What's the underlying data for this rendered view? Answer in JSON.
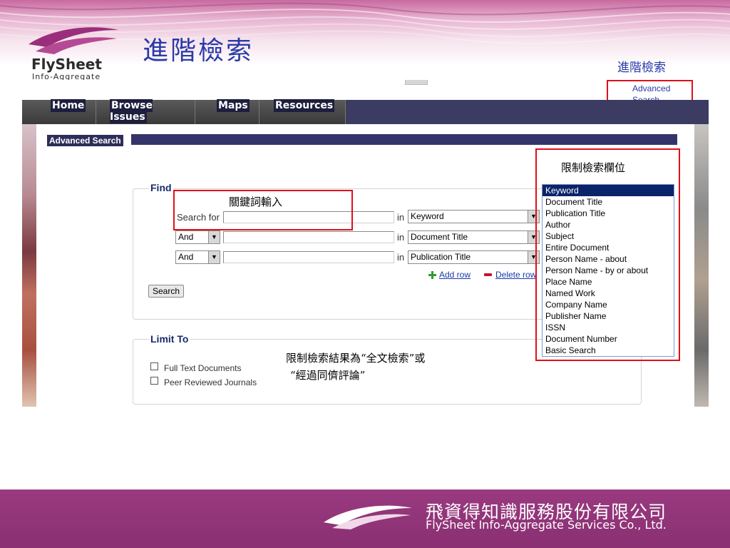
{
  "slide": {
    "title": "進階檢索",
    "top_note": "進階檢索",
    "logo": {
      "name": "FlySheet",
      "sub": "Info-Aggregate"
    },
    "company_cn": "飛資得知識服務股份有限公司",
    "company_en": "FlySheet Info-Aggregate Services Co., Ltd.",
    "colors": {
      "title": "#2a3aa8",
      "band": "#8a2f72",
      "annotation_box": "#e0101a"
    }
  },
  "nav": {
    "items": [
      {
        "label": "Home"
      },
      {
        "label": "Browse Issues"
      },
      {
        "label": "Maps"
      },
      {
        "label": "Resources"
      }
    ],
    "advanced_search_link": {
      "line1": "Advanced",
      "line2": "Search"
    }
  },
  "section": {
    "label": "Advanced Search"
  },
  "find": {
    "title": "Find",
    "search_for_label": "Search for",
    "in_label": "in",
    "rows": [
      {
        "operator": "",
        "value": "",
        "field": "Keyword"
      },
      {
        "operator": "And",
        "value": "",
        "field": "Document Title"
      },
      {
        "operator": "And",
        "value": "",
        "field": "Publication Title"
      }
    ],
    "add_row": "Add row",
    "delete_row": "Delete row",
    "search_button": "Search"
  },
  "limit": {
    "title": "Limit To",
    "options": [
      {
        "label": "Full Text Documents",
        "checked": false
      },
      {
        "label": "Peer Reviewed Journals",
        "checked": false
      }
    ]
  },
  "annotations": {
    "keyword_input": "關鍵詞輸入",
    "field_limit": "限制檢索欄位",
    "result_limit_line1": "限制檢索結果為“全文檢索”或",
    "result_limit_line2": "“經過同儕評論”"
  },
  "field_list": {
    "selected": "Keyword",
    "options": [
      "Keyword",
      "Document Title",
      "Publication Title",
      "Author",
      "Subject",
      "Entire Document",
      "Person Name - about",
      "Person Name - by or about",
      "Place Name",
      "Named Work",
      "Company Name",
      "Publisher Name",
      "ISSN",
      "Document Number",
      "Basic Search"
    ]
  }
}
